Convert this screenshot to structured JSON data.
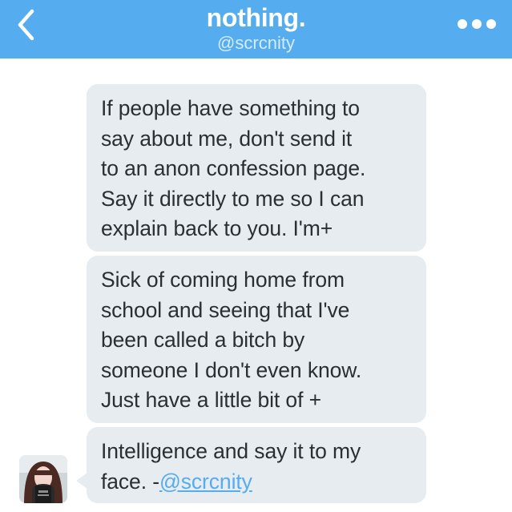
{
  "header": {
    "title": "nothing.",
    "subtitle": "@scrcnity",
    "back_icon": "chevron-left-icon",
    "more_icon": "more-horizontal-icon"
  },
  "colors": {
    "nav_bar": "#55acee",
    "bubble": "#e6ecf0",
    "text": "#292f33",
    "link": "#55acee"
  },
  "messages": [
    {
      "lines": [
        "If people have something to",
        "say about me, don't send it",
        "to an anon confession page.",
        "Say it directly to me so I can",
        "explain back to you. I'm+"
      ]
    },
    {
      "lines": [
        "Sick of coming home from",
        "school and seeing that I've",
        "been called a bitch by",
        "someone I don't even know.",
        "Just have a little bit of +"
      ]
    },
    {
      "lines": [
        "Intelligence and say it to my"
      ],
      "last_line_prefix": "face. -",
      "mention": "@scrcnity"
    }
  ]
}
